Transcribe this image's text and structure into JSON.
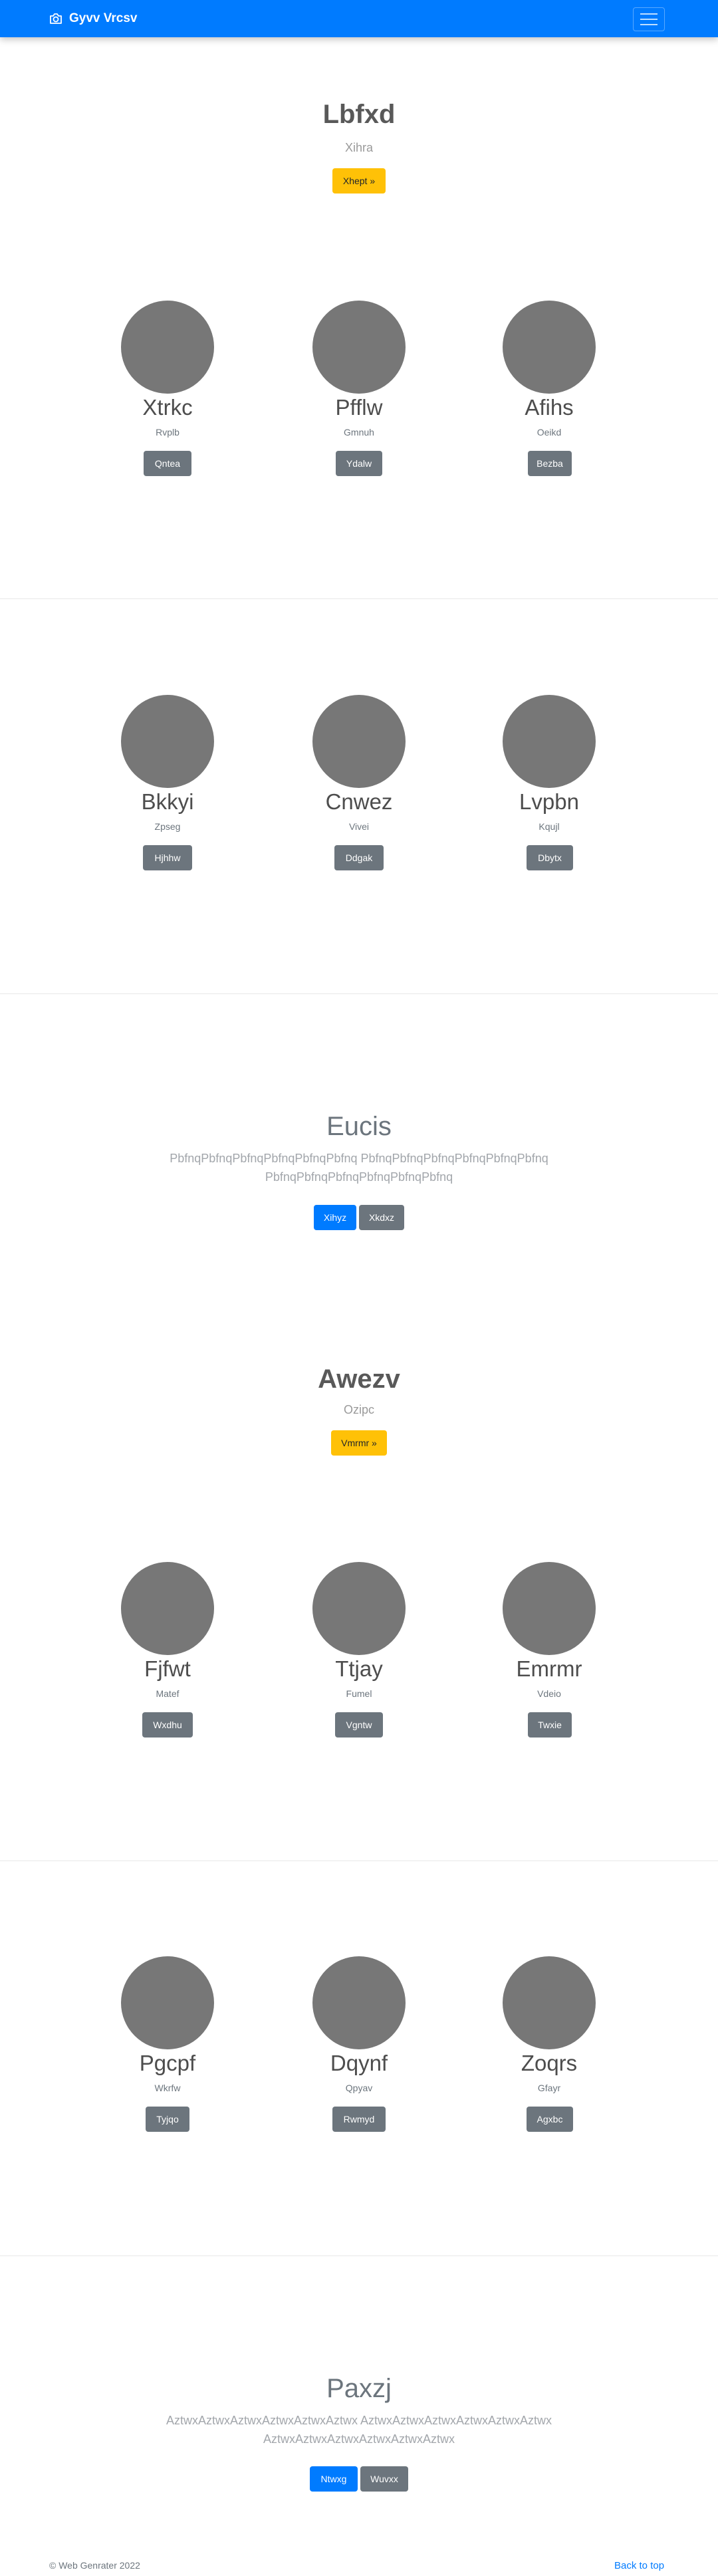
{
  "navbar": {
    "brand": "Gyvv Vrcsv",
    "brand_icon": "camera-icon",
    "toggler_icon": "hamburger-icon",
    "color": "#007bff"
  },
  "hero1": {
    "title": "Lbfxd",
    "subtitle": "Xihra",
    "button": "Xhept »"
  },
  "album1": {
    "row1": [
      {
        "name": "Xtrkc",
        "sub": "Rvplb",
        "button": "Qntea"
      },
      {
        "name": "Pfflw",
        "sub": "Gmnuh",
        "button": "Ydalw"
      },
      {
        "name": "Afihs",
        "sub": "Oeikd",
        "button": "Bezba"
      }
    ],
    "row2": [
      {
        "name": "Bkkyi",
        "sub": "Zpseg",
        "button": "Hjhhw"
      },
      {
        "name": "Cnwez",
        "sub": "Vivei",
        "button": "Ddgak"
      },
      {
        "name": "Lvpbn",
        "sub": "Kqujl",
        "button": "Dbytx"
      }
    ]
  },
  "jumbo1": {
    "title": "Eucis",
    "lead": "PbfnqPbfnqPbfnqPbfnqPbfnqPbfnq PbfnqPbfnqPbfnqPbfnqPbfnqPbfnq PbfnqPbfnqPbfnqPbfnqPbfnqPbfnq",
    "primary": "Xihyz",
    "secondary": "Xkdxz"
  },
  "hero2": {
    "title": "Awezv",
    "subtitle": "Ozipc",
    "button": "Vmrmr »"
  },
  "album2": {
    "row1": [
      {
        "name": "Fjfwt",
        "sub": "Matef",
        "button": "Wxdhu"
      },
      {
        "name": "Ttjay",
        "sub": "Fumel",
        "button": "Vgntw"
      },
      {
        "name": "Emrmr",
        "sub": "Vdeio",
        "button": "Twxie"
      }
    ],
    "row2": [
      {
        "name": "Pgcpf",
        "sub": "Wkrfw",
        "button": "Tyjqo"
      },
      {
        "name": "Dqynf",
        "sub": "Qpyav",
        "button": "Rwmyd"
      },
      {
        "name": "Zoqrs",
        "sub": "Gfayr",
        "button": "Agxbc"
      }
    ]
  },
  "jumbo2": {
    "title": "Paxzj",
    "lead": "AztwxAztwxAztwxAztwxAztwxAztwx AztwxAztwxAztwxAztwxAztwxAztwx AztwxAztwxAztwxAztwxAztwxAztwx",
    "primary": "Ntwxg",
    "secondary": "Wuvxx"
  },
  "footer": {
    "copyright": "© Web Genrater 2022",
    "back_to_top": "Back to top"
  }
}
